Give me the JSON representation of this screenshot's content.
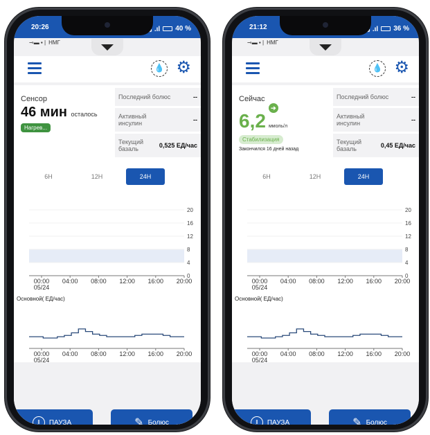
{
  "phones": [
    {
      "status": {
        "time": "20:26",
        "battery": "40 %"
      },
      "notif": "НМГ",
      "left": {
        "label": "Сенсор",
        "value": "46 мин",
        "value_suffix": "осталось",
        "badge": "Нагрев..."
      },
      "right": [
        {
          "label": "Последний болюс",
          "value": "--"
        },
        {
          "label": "Активный инсулин",
          "value": "--"
        },
        {
          "label": "Текущий базаль",
          "value": "0,525 ЕД/час"
        }
      ]
    },
    {
      "status": {
        "time": "21:12",
        "battery": "36 %"
      },
      "notif": "НМГ",
      "left": {
        "label": "Сейчас",
        "glucose": "6,2",
        "unit": "ммоль/л",
        "badge": "Стабилизация",
        "ended": "Закончился 16 дней назад"
      },
      "right": [
        {
          "label": "Последний болюс",
          "value": "--"
        },
        {
          "label": "Активный инсулин",
          "value": "--"
        },
        {
          "label": "Текущий базаль",
          "value": "0,45 ЕД/час"
        }
      ]
    }
  ],
  "tabs": [
    "6H",
    "12H",
    "24H"
  ],
  "active_tab": "24H",
  "chart_labels": {
    "y_ticks": [
      "20",
      "16",
      "12",
      "8",
      "4",
      "0"
    ],
    "x_ticks": [
      "00:00",
      "04:00",
      "08:00",
      "12:00",
      "16:00",
      "20:00"
    ],
    "date": "05/24",
    "basal_title": "Основной( ЕД/час)"
  },
  "buttons": {
    "pause": "ПАУЗА",
    "bolus": "Болюс"
  },
  "colors": {
    "primary": "#1a56b0",
    "green": "#6ab04c",
    "badge_green": "#3f9340",
    "range_band": "#e6ecf7"
  },
  "chart_data": [
    {
      "type": "line",
      "title": "",
      "xlabel": "",
      "ylabel": "Основной( ЕД/час)",
      "x": [
        "00:00",
        "01:00",
        "02:00",
        "03:00",
        "04:00",
        "05:00",
        "06:00",
        "07:00",
        "08:00",
        "09:00",
        "10:00",
        "11:00",
        "12:00",
        "13:00",
        "14:00",
        "15:00",
        "16:00",
        "17:00",
        "18:00",
        "19:00",
        "20:00",
        "21:00"
      ],
      "series": [
        {
          "values": [
            0.45,
            0.45,
            0.4,
            0.4,
            0.45,
            0.5,
            0.6,
            0.75,
            0.65,
            0.55,
            0.5,
            0.45,
            0.45,
            0.45,
            0.45,
            0.5,
            0.55,
            0.55,
            0.55,
            0.5,
            0.45,
            0.45
          ]
        }
      ],
      "target_range": [
        4,
        8
      ],
      "glucose_ylim": [
        0,
        20
      ]
    }
  ]
}
